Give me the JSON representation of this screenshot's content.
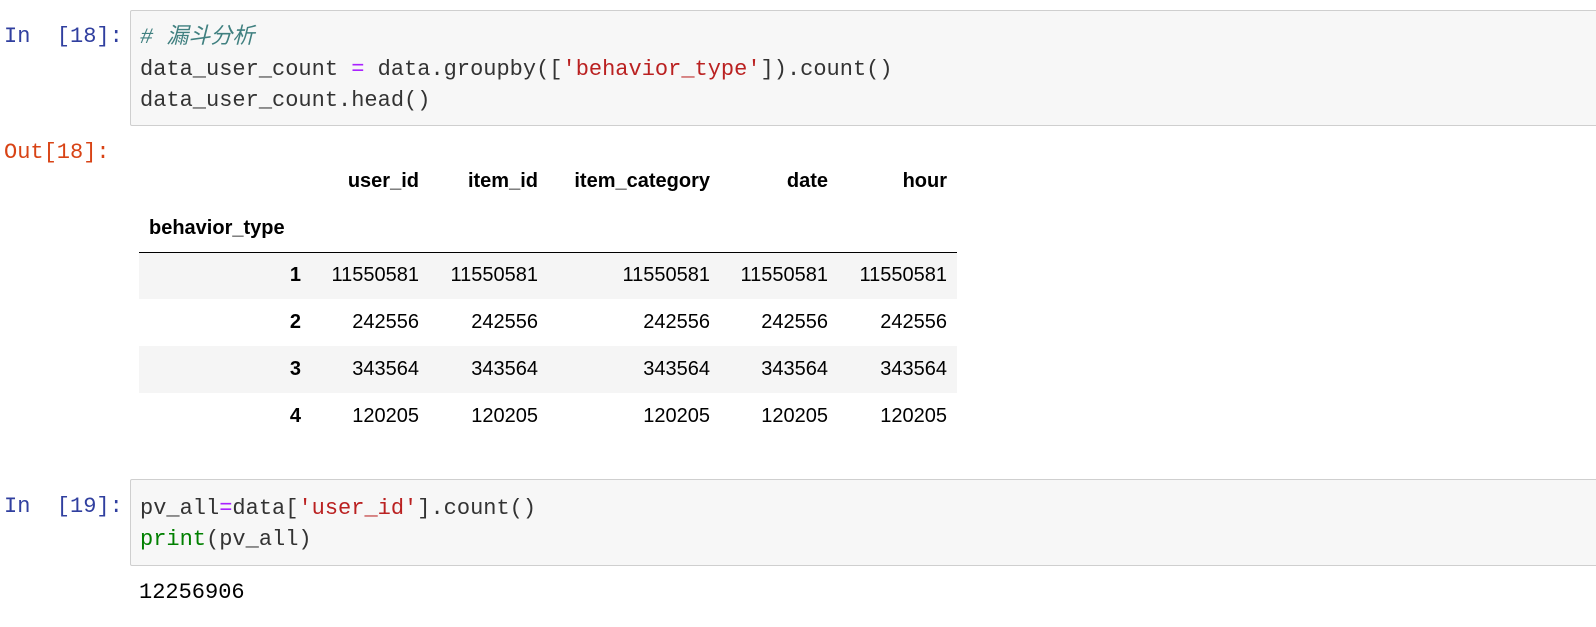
{
  "cell18": {
    "in_prompt": "In  [18]:",
    "out_prompt": "Out[18]:",
    "comment": "# 漏斗分析",
    "line2": {
      "var": "data_user_count",
      "eq": "=",
      "pre": "data.groupby([",
      "str": "'behavior_type'",
      "post": "]).count()"
    },
    "line3": "data_user_count.head()"
  },
  "table": {
    "columns": [
      "user_id",
      "item_id",
      "item_category",
      "date",
      "hour"
    ],
    "index_name": "behavior_type",
    "rows": [
      {
        "index": "1",
        "values": [
          "11550581",
          "11550581",
          "11550581",
          "11550581",
          "11550581"
        ]
      },
      {
        "index": "2",
        "values": [
          "242556",
          "242556",
          "242556",
          "242556",
          "242556"
        ]
      },
      {
        "index": "3",
        "values": [
          "343564",
          "343564",
          "343564",
          "343564",
          "343564"
        ]
      },
      {
        "index": "4",
        "values": [
          "120205",
          "120205",
          "120205",
          "120205",
          "120205"
        ]
      }
    ]
  },
  "cell19": {
    "in_prompt": "In  [19]:",
    "line1": {
      "var": "pv_all",
      "eq": "=",
      "pre": "data[",
      "str": "'user_id'",
      "post": "].count()"
    },
    "line2": {
      "fn": "print",
      "args": "(pv_all)"
    },
    "output": "12256906"
  }
}
